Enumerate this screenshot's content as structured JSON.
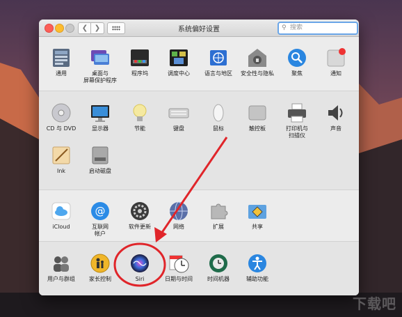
{
  "window": {
    "title": "系统偏好设置",
    "search_placeholder": "搜索"
  },
  "sections": [
    {
      "items": [
        {
          "label": "通用",
          "icon": "general-icon"
        },
        {
          "label": "桌面与\n屏幕保护程序",
          "icon": "desktop-screensaver-icon"
        },
        {
          "label": "程序坞",
          "icon": "dock-icon"
        },
        {
          "label": "调度中心",
          "icon": "mission-control-icon"
        },
        {
          "label": "语言与地区",
          "icon": "language-region-icon"
        },
        {
          "label": "安全性与隐私",
          "icon": "security-privacy-icon"
        },
        {
          "label": "聚焦",
          "icon": "spotlight-icon"
        },
        {
          "label": "通知",
          "icon": "notifications-icon"
        }
      ]
    },
    {
      "items": [
        {
          "label": "CD 与 DVD",
          "icon": "cd-dvd-icon"
        },
        {
          "label": "显示器",
          "icon": "displays-icon"
        },
        {
          "label": "节能",
          "icon": "energy-saver-icon"
        },
        {
          "label": "键盘",
          "icon": "keyboard-icon"
        },
        {
          "label": "鼠标",
          "icon": "mouse-icon"
        },
        {
          "label": "触控板",
          "icon": "trackpad-icon"
        },
        {
          "label": "打印机与\n扫描仪",
          "icon": "printers-scanners-icon"
        },
        {
          "label": "声音",
          "icon": "sound-icon"
        },
        {
          "label": "Ink",
          "icon": "ink-icon"
        },
        {
          "label": "启动磁盘",
          "icon": "startup-disk-icon"
        }
      ]
    },
    {
      "items": [
        {
          "label": "iCloud",
          "icon": "icloud-icon"
        },
        {
          "label": "互联网\n帐户",
          "icon": "internet-accounts-icon"
        },
        {
          "label": "软件更新",
          "icon": "software-update-icon"
        },
        {
          "label": "网络",
          "icon": "network-icon"
        },
        {
          "label": "扩展",
          "icon": "extensions-icon"
        },
        {
          "label": "共享",
          "icon": "sharing-icon"
        }
      ]
    },
    {
      "items": [
        {
          "label": "用户与群组",
          "icon": "users-groups-icon"
        },
        {
          "label": "家长控制",
          "icon": "parental-controls-icon"
        },
        {
          "label": "Siri",
          "icon": "siri-icon"
        },
        {
          "label": "日期与时间",
          "icon": "date-time-icon"
        },
        {
          "label": "时间机器",
          "icon": "time-machine-icon"
        },
        {
          "label": "辅助功能",
          "icon": "accessibility-icon"
        }
      ]
    }
  ],
  "annotation": {
    "highlight": "Siri",
    "highlight_color": "#e0252a"
  },
  "watermark": "下载吧"
}
